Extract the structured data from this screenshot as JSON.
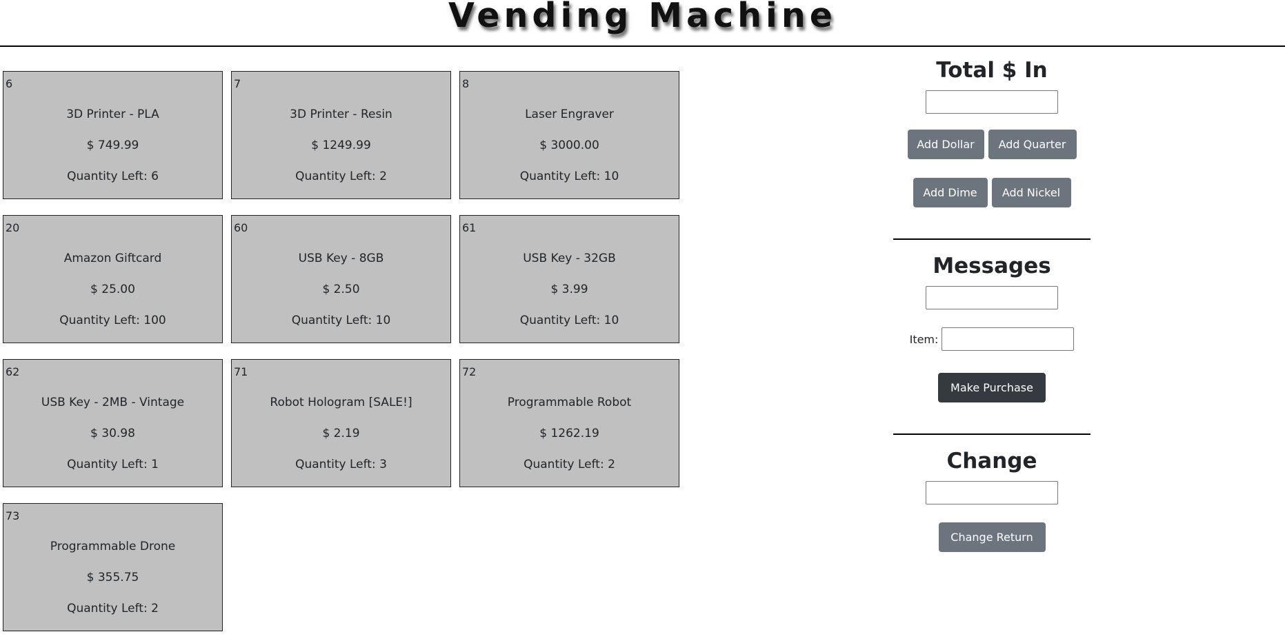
{
  "header": {
    "title": "Vending Machine"
  },
  "items": [
    {
      "id": "6",
      "name": "3D Printer - PLA",
      "price": "$ 749.99",
      "qty": "Quantity Left: 6"
    },
    {
      "id": "7",
      "name": "3D Printer - Resin",
      "price": "$ 1249.99",
      "qty": "Quantity Left: 2"
    },
    {
      "id": "8",
      "name": "Laser Engraver",
      "price": "$ 3000.00",
      "qty": "Quantity Left: 10"
    },
    {
      "id": "20",
      "name": "Amazon Giftcard",
      "price": "$ 25.00",
      "qty": "Quantity Left: 100"
    },
    {
      "id": "60",
      "name": "USB Key - 8GB",
      "price": "$ 2.50",
      "qty": "Quantity Left: 10"
    },
    {
      "id": "61",
      "name": "USB Key - 32GB",
      "price": "$ 3.99",
      "qty": "Quantity Left: 10"
    },
    {
      "id": "62",
      "name": "USB Key - 2MB - Vintage",
      "price": "$ 30.98",
      "qty": "Quantity Left: 1"
    },
    {
      "id": "71",
      "name": "Robot Hologram [SALE!]",
      "price": "$ 2.19",
      "qty": "Quantity Left: 3"
    },
    {
      "id": "72",
      "name": "Programmable Robot",
      "price": "$ 1262.19",
      "qty": "Quantity Left: 2"
    },
    {
      "id": "73",
      "name": "Programmable Drone",
      "price": "$ 355.75",
      "qty": "Quantity Left: 2"
    }
  ],
  "panel": {
    "total_title": "Total $ In",
    "total_value": "",
    "buttons": {
      "add_dollar": "Add Dollar",
      "add_quarter": "Add Quarter",
      "add_dime": "Add Dime",
      "add_nickel": "Add Nickel",
      "make_purchase": "Make Purchase",
      "change_return": "Change Return"
    },
    "messages_title": "Messages",
    "messages_value": "",
    "item_label": "Item:",
    "item_value": "",
    "change_title": "Change",
    "change_value": ""
  },
  "colors": {
    "item_bg": "#c0c0c0",
    "button_secondary": "#6c757d",
    "button_dark": "#343a40"
  }
}
